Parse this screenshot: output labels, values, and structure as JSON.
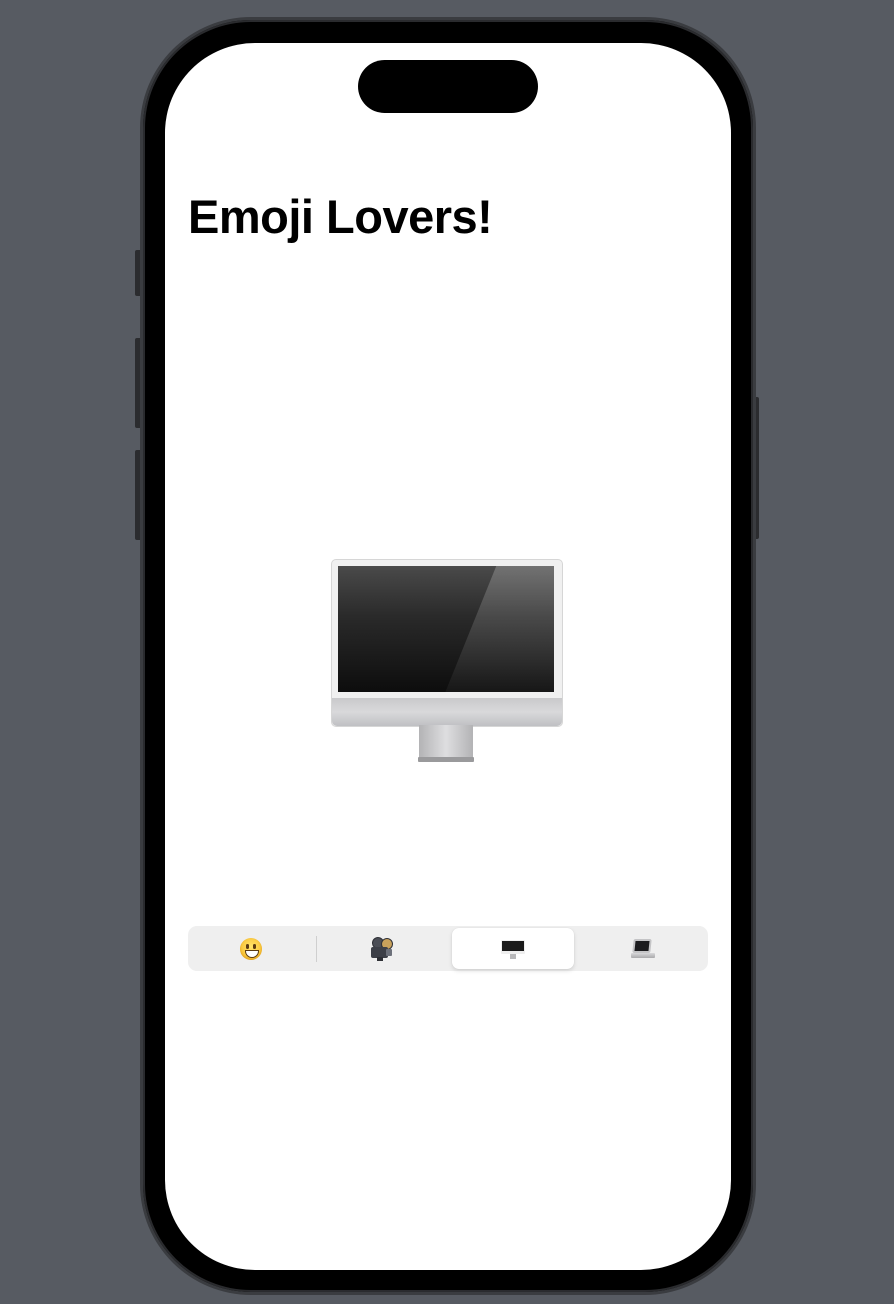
{
  "app": {
    "title": "Emoji Lovers!"
  },
  "display": {
    "selected_emoji_icon": "desktop-computer-icon"
  },
  "segmented_control": {
    "selected_index": 2,
    "segments": [
      {
        "icon": "grinning-face-icon"
      },
      {
        "icon": "film-projector-icon"
      },
      {
        "icon": "desktop-computer-icon"
      },
      {
        "icon": "laptop-icon"
      }
    ]
  }
}
